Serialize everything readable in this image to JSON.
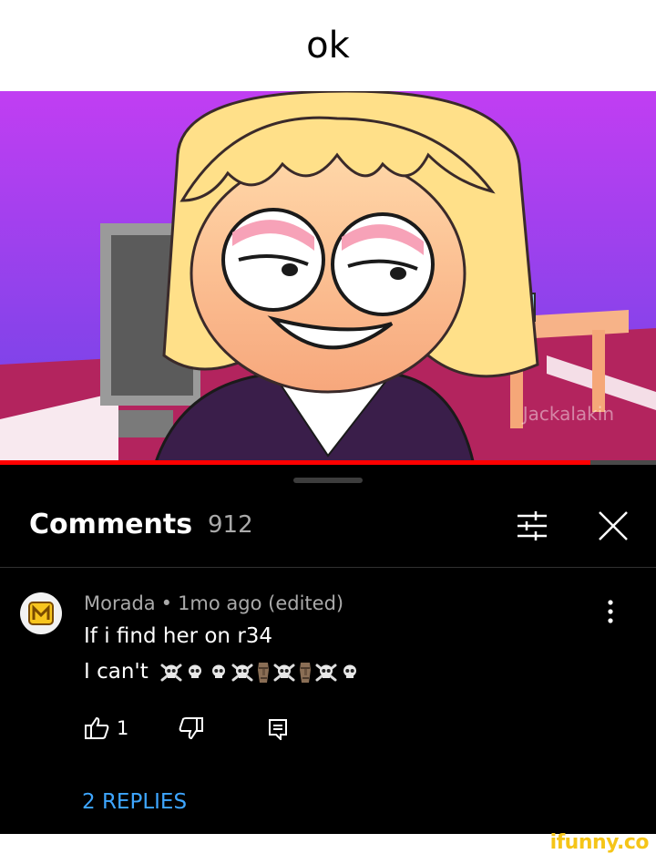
{
  "caption": "ok",
  "video": {
    "watermark": "Jackalakin",
    "progress": 0.9
  },
  "comments_panel": {
    "title": "Comments",
    "count": "912",
    "sort_icon": "sort-sliders-icon",
    "close_icon": "close-icon",
    "comment": {
      "author": "Morada",
      "time": "1mo ago",
      "edited": "(edited)",
      "line1": "If i find her on r34",
      "line2": "I can't",
      "emojis": [
        "skull-crossbones",
        "skull",
        "skull",
        "skull-crossbones",
        "moai",
        "skull-crossbones",
        "moai",
        "skull-crossbones",
        "skull"
      ],
      "likes": "1"
    },
    "replies_label": "2 REPLIES"
  },
  "site_watermark": "ifunny.co",
  "colors": {
    "accent_blue": "#3ea6ff",
    "progress_red": "#ff0000",
    "video_bg": "#b33ff0"
  }
}
